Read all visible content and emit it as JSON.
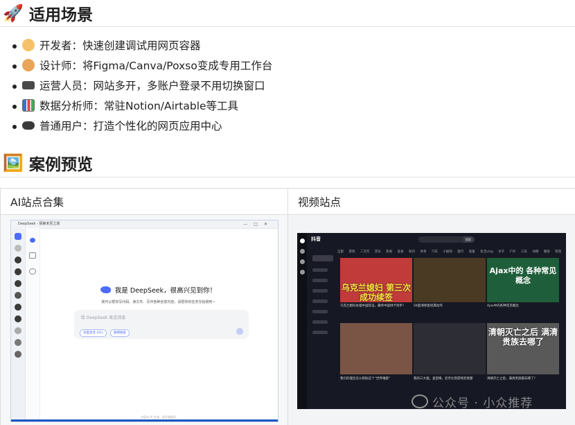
{
  "section1": {
    "emoji": "🚀",
    "title": "适用场景"
  },
  "items": [
    {
      "icon": "person-face-icon",
      "color": "#f5c26b",
      "text": "开发者：快速创建调试用网页容器"
    },
    {
      "icon": "palette-icon",
      "color": "#e9a55a",
      "text": "设计师：将Figma/Canva/Poxso变成专用工作台"
    },
    {
      "icon": "laptop-icon",
      "color": "#4a4a4a",
      "text": "运营人员：网站多开，多账户登录不用切换窗口"
    },
    {
      "icon": "bar-chart-icon",
      "color": "#3b6fd6",
      "text": "数据分析师：常驻Notion/Airtable等工具"
    },
    {
      "icon": "gamepad-icon",
      "color": "#3a3a3a",
      "text": "普通用户：打造个性化的网页应用中心"
    }
  ],
  "section2": {
    "emoji": "🖼️",
    "title": "案例预览"
  },
  "table": {
    "col1": "AI站点合集",
    "col2": "视频站点"
  },
  "shot1": {
    "window_title": "DeepSeek - 探索未至之境",
    "hello": "我是 DeepSeek，很高兴见到你！",
    "sub": "我可以帮你写代码、读文件、写作各种创意内容，请把你的任务交给我吧~",
    "placeholder": "给 DeepSeek 发送消息",
    "pill1": "深度思考 (R1)",
    "pill2": "联网搜索",
    "footer": "内容由 AI 生成，请仔细甄别"
  },
  "shot2": {
    "app": "抖音",
    "tabs": "全部 游戏 二次元 音乐 影视 美食 知识 体育 汽车 小剧场 旅行 鬼畜 生活vlog 亲子 户外 三农 动物 健身 萌宠 穿搭",
    "search_btn": "搜索",
    "thumbs": [
      {
        "caption": "乌克兰媳妇 第三次成功续签",
        "color": "#ffe13d",
        "bg": "#c23b3b"
      },
      {
        "caption": "",
        "color": "#fff",
        "bg": "#4a3a24"
      },
      {
        "caption": "Ajax中的 各种常见 概念",
        "color": "#ffffff",
        "bg": "#1f5e3a"
      },
      {
        "caption": "",
        "color": "#fff",
        "bg": "#6a4a3a"
      },
      {
        "caption": "",
        "color": "#fff",
        "bg": "#2d2d36"
      },
      {
        "caption": "清朝灭亡之后 满清贵族去哪了",
        "color": "#ffffff",
        "bg": "#595959"
      }
    ],
    "desc1": "乌克兰媳妇办理中国签证，最终中国绿卡到手！",
    "desc2": "5K超清修复经典动作",
    "desc3": "Ajax中的各种常见概念",
    "desc4": "我们的理念怎么帮助这个“世界难题”",
    "desc5": "我的三大理，查后悔，近乎比刻游戏老爸都",
    "desc6": "清朝灭亡之后，满清贵族都去哪了？"
  },
  "watermark": "公众号 · 小众推荐"
}
